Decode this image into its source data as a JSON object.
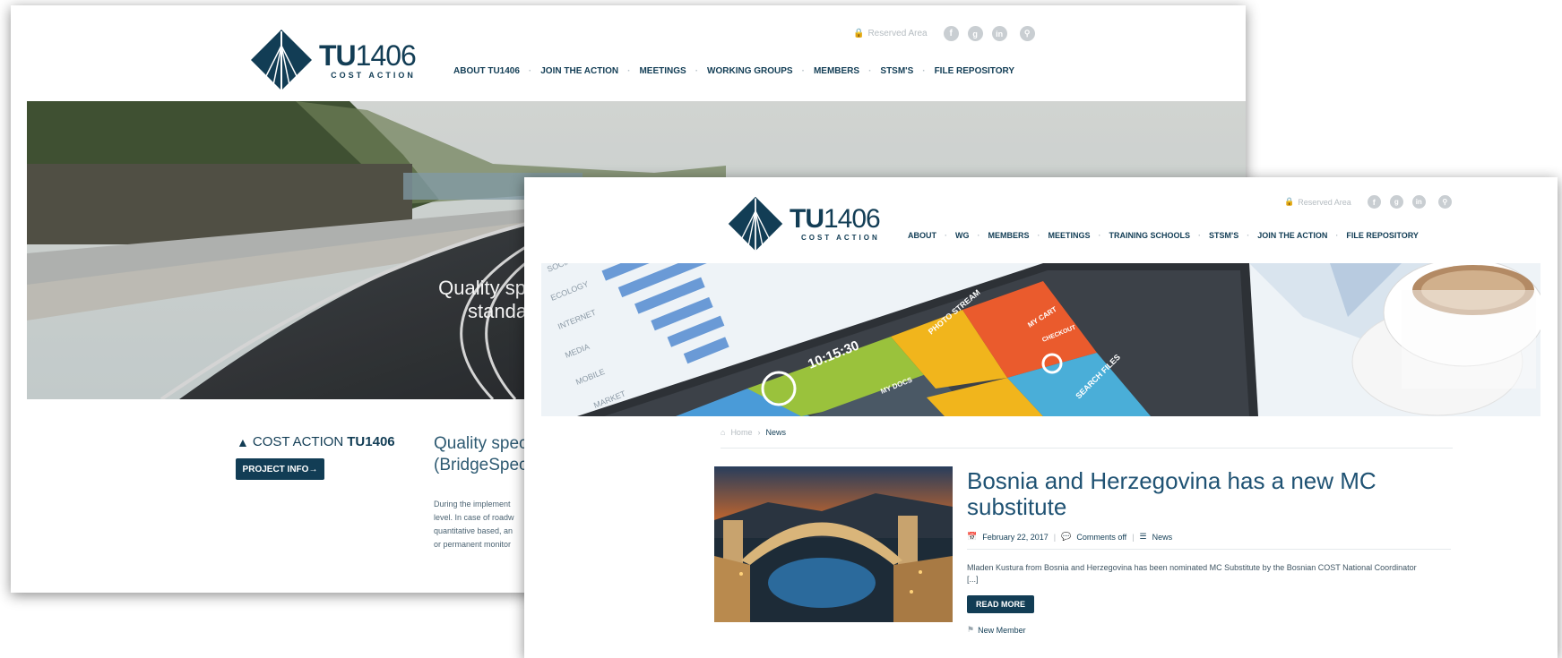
{
  "back_window": {
    "logo": {
      "tu": "TU",
      "num": "1406",
      "subtitle": "COST ACTION"
    },
    "top_links": {
      "reserved": "Reserved Area"
    },
    "nav": [
      "ABOUT TU1406",
      "JOIN THE ACTION",
      "MEETINGS",
      "WORKING GROUPS",
      "MEMBERS",
      "STSM'S",
      "FILE REPOSITORY"
    ],
    "hero_text": [
      "Quality sp",
      "standa"
    ],
    "cost_action": {
      "prefix": "COST ACTION",
      "code": "TU1406"
    },
    "project_button": "PROJECT INFO→",
    "quality_heading": [
      "Quality spec",
      "(BridgeSpec)"
    ],
    "body_lines": [
      "During the implement",
      "level. In case of roadw",
      "quantitative based, an",
      "or permanent monitor"
    ]
  },
  "front_window": {
    "logo": {
      "tu": "TU",
      "num": "1406",
      "subtitle": "COST ACTION"
    },
    "top_links": {
      "reserved": "Reserved Area"
    },
    "nav": [
      "ABOUT",
      "WG",
      "MEMBERS",
      "MEETINGS",
      "TRAINING SCHOOLS",
      "STSM'S",
      "JOIN THE ACTION",
      "FILE REPOSITORY"
    ],
    "banner": {
      "bar_labels": [
        "SOCIAL",
        "ECOLOGY",
        "INTERNET",
        "MEDIA",
        "MOBILE",
        "MARKET"
      ],
      "clock_time": "10:15:30",
      "tiles": {
        "photo": "PHOTO STREAM",
        "cart": "MY CART",
        "checkout": "CHECKOUT",
        "docs": "MY DOCS",
        "search": "SEARCH FILES"
      }
    },
    "breadcrumb": {
      "home": "Home",
      "current": "News"
    },
    "article": {
      "title": "Bosnia and Herzegovina has a new MC substitute",
      "date": "February 22, 2017",
      "comments": "Comments off",
      "category": "News",
      "excerpt": "Mladen Kustura from Bosnia and Herzegovina has been nominated MC Substitute by the Bosnian COST National Coordinator",
      "excerpt_more": "[...]",
      "read_more": "READ MORE",
      "tag": "New Member"
    }
  },
  "colors": {
    "brand": "#123d55",
    "muted": "#b5bcc1"
  }
}
